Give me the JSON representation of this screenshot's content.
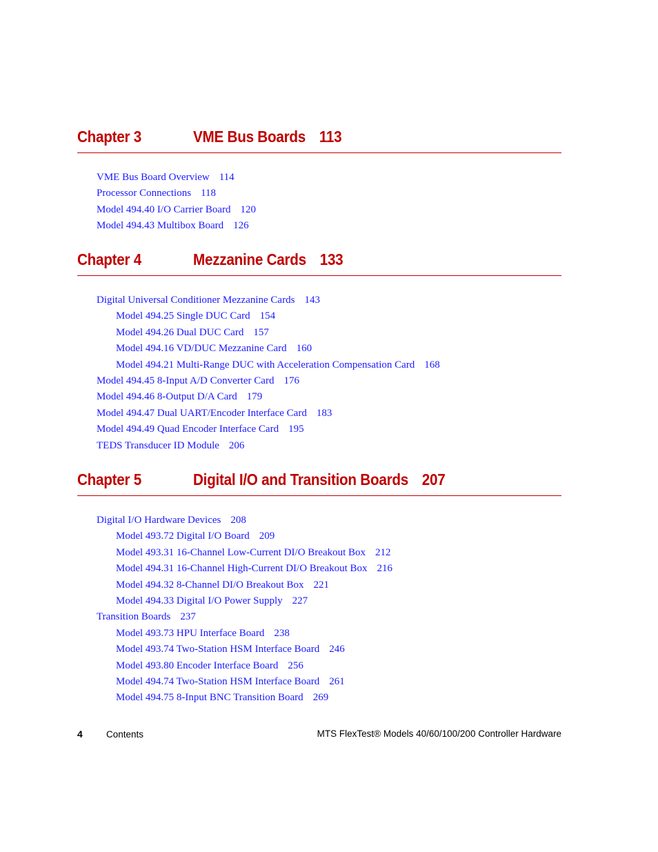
{
  "chapters": [
    {
      "label": "Chapter 3",
      "title": "VME Bus Boards",
      "page": "113",
      "entries": [
        {
          "text": "VME Bus Board Overview",
          "page": "114",
          "level": 1
        },
        {
          "text": "Processor Connections",
          "page": "118",
          "level": 1
        },
        {
          "text": "Model 494.40 I/O Carrier Board",
          "page": "120",
          "level": 1
        },
        {
          "text": "Model 494.43 Multibox Board",
          "page": "126",
          "level": 1
        }
      ]
    },
    {
      "label": "Chapter 4",
      "title": "Mezzanine Cards",
      "page": "133",
      "entries": [
        {
          "text": "Digital Universal Conditioner Mezzanine Cards",
          "page": "143",
          "level": 1
        },
        {
          "text": "Model 494.25 Single DUC Card",
          "page": "154",
          "level": 2
        },
        {
          "text": "Model 494.26 Dual DUC Card",
          "page": "157",
          "level": 2
        },
        {
          "text": "Model 494.16 VD/DUC Mezzanine Card",
          "page": "160",
          "level": 2
        },
        {
          "text": "Model 494.21 Multi-Range DUC with Acceleration Compensation Card",
          "page": "168",
          "level": 2
        },
        {
          "text": "Model 494.45 8-Input A/D Converter Card",
          "page": "176",
          "level": 1
        },
        {
          "text": "Model 494.46 8-Output D/A Card",
          "page": "179",
          "level": 1
        },
        {
          "text": "Model 494.47 Dual UART/Encoder Interface Card",
          "page": "183",
          "level": 1
        },
        {
          "text": "Model 494.49 Quad Encoder Interface Card",
          "page": "195",
          "level": 1
        },
        {
          "text": "TEDS Transducer ID Module",
          "page": "206",
          "level": 1
        }
      ]
    },
    {
      "label": "Chapter 5",
      "title": "Digital I/O and Transition Boards",
      "page": "207",
      "entries": [
        {
          "text": "Digital I/O Hardware Devices",
          "page": "208",
          "level": 1
        },
        {
          "text": "Model 493.72 Digital I/O Board",
          "page": "209",
          "level": 2
        },
        {
          "text": "Model 493.31 16-Channel Low-Current DI/O Breakout Box",
          "page": "212",
          "level": 2
        },
        {
          "text": "Model 494.31 16-Channel High-Current DI/O Breakout Box",
          "page": "216",
          "level": 2
        },
        {
          "text": "Model 494.32 8-Channel DI/O Breakout Box",
          "page": "221",
          "level": 2
        },
        {
          "text": "Model 494.33 Digital I/O Power Supply",
          "page": "227",
          "level": 2
        },
        {
          "text": "Transition Boards",
          "page": "237",
          "level": 1
        },
        {
          "text": "Model 493.73 HPU Interface Board",
          "page": "238",
          "level": 2
        },
        {
          "text": "Model 493.74 Two-Station HSM Interface Board",
          "page": "246",
          "level": 2
        },
        {
          "text": "Model 493.80 Encoder Interface Board",
          "page": "256",
          "level": 2
        },
        {
          "text": "Model 494.74 Two-Station HSM Interface Board",
          "page": "261",
          "level": 2
        },
        {
          "text": "Model 494.75 8-Input BNC Transition Board",
          "page": "269",
          "level": 2
        }
      ]
    }
  ],
  "footer": {
    "page_number": "4",
    "section": "Contents",
    "doc_title": "MTS FlexTest® Models 40/60/100/200 Controller Hardware"
  }
}
